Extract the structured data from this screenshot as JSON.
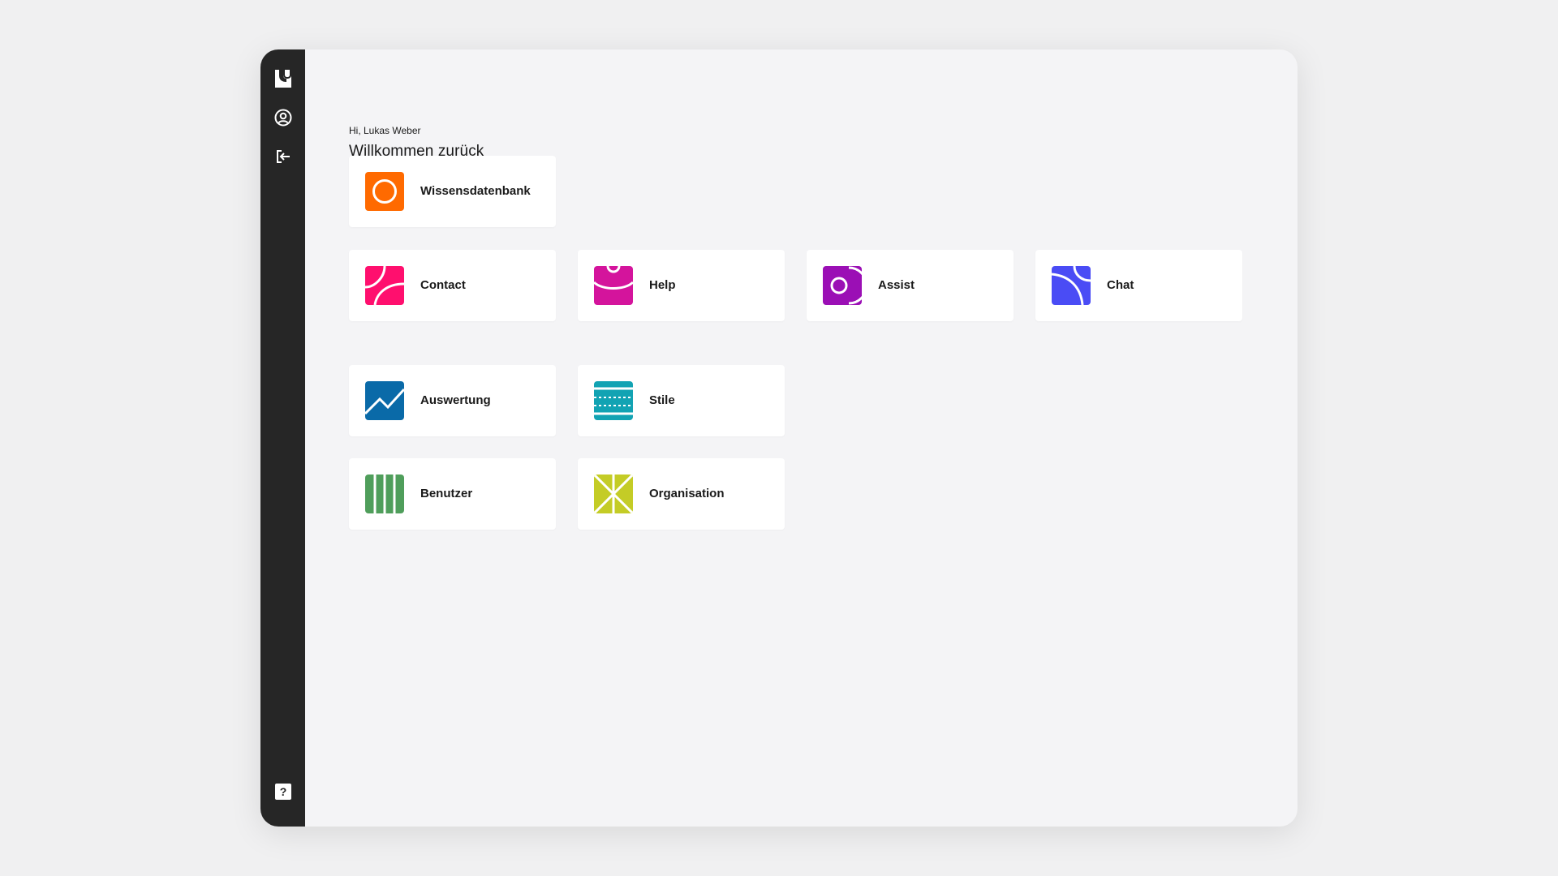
{
  "header": {
    "greeting": "Hi, Lukas Weber",
    "title": "Willkommen zurück"
  },
  "sidebar": {
    "items": [
      {
        "icon": "logo-icon"
      },
      {
        "icon": "user-profile-icon"
      },
      {
        "icon": "logout-icon"
      },
      {
        "icon": "help-icon",
        "symbol": "?"
      }
    ]
  },
  "apps": {
    "wissensdatenbank": {
      "label": "Wissensdatenbank",
      "color": "#ff6a00",
      "icon": "circle-icon"
    },
    "contact": {
      "label": "Contact",
      "color": "#ff0f6e",
      "icon": "contact-icon"
    },
    "help": {
      "label": "Help",
      "color": "#d4149c",
      "icon": "help-app-icon"
    },
    "assist": {
      "label": "Assist",
      "color": "#9b0fb5",
      "icon": "assist-icon"
    },
    "chat": {
      "label": "Chat",
      "color": "#4a4cf5",
      "icon": "chat-icon"
    },
    "auswertung": {
      "label": "Auswertung",
      "color": "#0a6aa8",
      "icon": "chart-line-icon"
    },
    "stile": {
      "label": "Stile",
      "color": "#12a3b3",
      "icon": "styles-icon"
    },
    "benutzer": {
      "label": "Benutzer",
      "color": "#4f9e5b",
      "icon": "users-icon"
    },
    "organisation": {
      "label": "Organisation",
      "color": "#c4cc26",
      "icon": "organisation-icon"
    }
  }
}
